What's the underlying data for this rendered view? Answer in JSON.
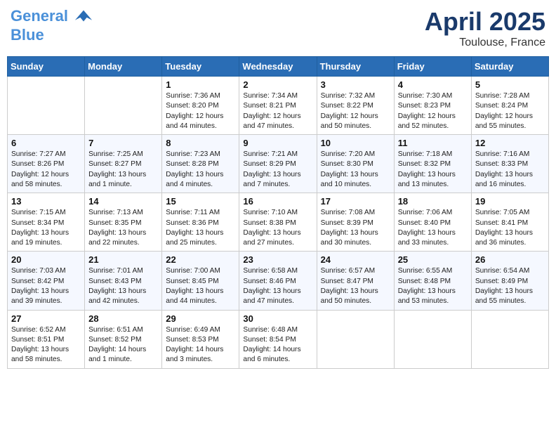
{
  "header": {
    "logo_line1": "General",
    "logo_line2": "Blue",
    "month": "April 2025",
    "location": "Toulouse, France"
  },
  "weekdays": [
    "Sunday",
    "Monday",
    "Tuesday",
    "Wednesday",
    "Thursday",
    "Friday",
    "Saturday"
  ],
  "weeks": [
    [
      {
        "day": "",
        "info": ""
      },
      {
        "day": "",
        "info": ""
      },
      {
        "day": "1",
        "info": "Sunrise: 7:36 AM\nSunset: 8:20 PM\nDaylight: 12 hours and 44 minutes."
      },
      {
        "day": "2",
        "info": "Sunrise: 7:34 AM\nSunset: 8:21 PM\nDaylight: 12 hours and 47 minutes."
      },
      {
        "day": "3",
        "info": "Sunrise: 7:32 AM\nSunset: 8:22 PM\nDaylight: 12 hours and 50 minutes."
      },
      {
        "day": "4",
        "info": "Sunrise: 7:30 AM\nSunset: 8:23 PM\nDaylight: 12 hours and 52 minutes."
      },
      {
        "day": "5",
        "info": "Sunrise: 7:28 AM\nSunset: 8:24 PM\nDaylight: 12 hours and 55 minutes."
      }
    ],
    [
      {
        "day": "6",
        "info": "Sunrise: 7:27 AM\nSunset: 8:26 PM\nDaylight: 12 hours and 58 minutes."
      },
      {
        "day": "7",
        "info": "Sunrise: 7:25 AM\nSunset: 8:27 PM\nDaylight: 13 hours and 1 minute."
      },
      {
        "day": "8",
        "info": "Sunrise: 7:23 AM\nSunset: 8:28 PM\nDaylight: 13 hours and 4 minutes."
      },
      {
        "day": "9",
        "info": "Sunrise: 7:21 AM\nSunset: 8:29 PM\nDaylight: 13 hours and 7 minutes."
      },
      {
        "day": "10",
        "info": "Sunrise: 7:20 AM\nSunset: 8:30 PM\nDaylight: 13 hours and 10 minutes."
      },
      {
        "day": "11",
        "info": "Sunrise: 7:18 AM\nSunset: 8:32 PM\nDaylight: 13 hours and 13 minutes."
      },
      {
        "day": "12",
        "info": "Sunrise: 7:16 AM\nSunset: 8:33 PM\nDaylight: 13 hours and 16 minutes."
      }
    ],
    [
      {
        "day": "13",
        "info": "Sunrise: 7:15 AM\nSunset: 8:34 PM\nDaylight: 13 hours and 19 minutes."
      },
      {
        "day": "14",
        "info": "Sunrise: 7:13 AM\nSunset: 8:35 PM\nDaylight: 13 hours and 22 minutes."
      },
      {
        "day": "15",
        "info": "Sunrise: 7:11 AM\nSunset: 8:36 PM\nDaylight: 13 hours and 25 minutes."
      },
      {
        "day": "16",
        "info": "Sunrise: 7:10 AM\nSunset: 8:38 PM\nDaylight: 13 hours and 27 minutes."
      },
      {
        "day": "17",
        "info": "Sunrise: 7:08 AM\nSunset: 8:39 PM\nDaylight: 13 hours and 30 minutes."
      },
      {
        "day": "18",
        "info": "Sunrise: 7:06 AM\nSunset: 8:40 PM\nDaylight: 13 hours and 33 minutes."
      },
      {
        "day": "19",
        "info": "Sunrise: 7:05 AM\nSunset: 8:41 PM\nDaylight: 13 hours and 36 minutes."
      }
    ],
    [
      {
        "day": "20",
        "info": "Sunrise: 7:03 AM\nSunset: 8:42 PM\nDaylight: 13 hours and 39 minutes."
      },
      {
        "day": "21",
        "info": "Sunrise: 7:01 AM\nSunset: 8:43 PM\nDaylight: 13 hours and 42 minutes."
      },
      {
        "day": "22",
        "info": "Sunrise: 7:00 AM\nSunset: 8:45 PM\nDaylight: 13 hours and 44 minutes."
      },
      {
        "day": "23",
        "info": "Sunrise: 6:58 AM\nSunset: 8:46 PM\nDaylight: 13 hours and 47 minutes."
      },
      {
        "day": "24",
        "info": "Sunrise: 6:57 AM\nSunset: 8:47 PM\nDaylight: 13 hours and 50 minutes."
      },
      {
        "day": "25",
        "info": "Sunrise: 6:55 AM\nSunset: 8:48 PM\nDaylight: 13 hours and 53 minutes."
      },
      {
        "day": "26",
        "info": "Sunrise: 6:54 AM\nSunset: 8:49 PM\nDaylight: 13 hours and 55 minutes."
      }
    ],
    [
      {
        "day": "27",
        "info": "Sunrise: 6:52 AM\nSunset: 8:51 PM\nDaylight: 13 hours and 58 minutes."
      },
      {
        "day": "28",
        "info": "Sunrise: 6:51 AM\nSunset: 8:52 PM\nDaylight: 14 hours and 1 minute."
      },
      {
        "day": "29",
        "info": "Sunrise: 6:49 AM\nSunset: 8:53 PM\nDaylight: 14 hours and 3 minutes."
      },
      {
        "day": "30",
        "info": "Sunrise: 6:48 AM\nSunset: 8:54 PM\nDaylight: 14 hours and 6 minutes."
      },
      {
        "day": "",
        "info": ""
      },
      {
        "day": "",
        "info": ""
      },
      {
        "day": "",
        "info": ""
      }
    ]
  ]
}
